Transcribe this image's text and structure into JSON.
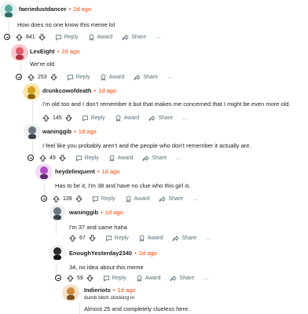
{
  "labels": {
    "reply": "Reply",
    "award": "Award",
    "share": "Share",
    "more": "…",
    "dot": "•"
  },
  "colors": {
    "accent_time": "#ff4500",
    "muted": "#576f76",
    "thread_line": "#e2e5e8"
  },
  "comments": [
    {
      "user": "faeriedustdancer",
      "time": "2d ago",
      "text": "How does no one know this meme lol",
      "votes": "841",
      "flair": ""
    },
    {
      "user": "LexEight",
      "time": "2d ago",
      "text": "We're old",
      "votes": "253",
      "flair": ""
    },
    {
      "user": "drunkcowofdeath",
      "time": "1d ago",
      "text": "I'm old too and I don't remember it but that makes me concerned that I might be even more old.",
      "votes": "145",
      "flair": ""
    },
    {
      "user": "waninggib",
      "time": "1d ago",
      "text": "I feel like you probably aren't and the people who don't remember it actually are.",
      "votes": "49",
      "flair": ""
    },
    {
      "user": "heydelinquent",
      "time": "1d ago",
      "text": "Has to be it, I'm 38 and have no clue who this girl is.",
      "votes": "139",
      "flair": ""
    },
    {
      "user": "waninggib",
      "time": "1d ago",
      "text": "I'm 37 and same haha",
      "votes": "67",
      "flair": ""
    },
    {
      "user": "EnoughYesterday2340",
      "time": "1d ago",
      "text": "34, no idea about this meme",
      "votes": "59",
      "flair": ""
    },
    {
      "user": "Indieriots",
      "time": "1d ago",
      "text": "Almost 25 and completely clueless here.",
      "votes": "",
      "flair": "dumb bitch clocking in"
    }
  ]
}
